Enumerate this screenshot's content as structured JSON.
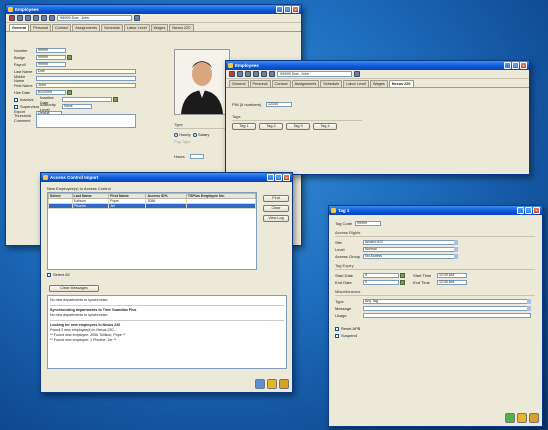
{
  "employees_window": {
    "title": "Employees",
    "selector_value": "99999 Doe, John",
    "tabs": [
      "General",
      "Personal",
      "Contact",
      "Assignments",
      "Schedule",
      "Labor Level",
      "Wages",
      "Nexus 220"
    ],
    "fields": [
      {
        "label": "Number",
        "value": "99999"
      },
      {
        "label": "Badge",
        "value": "99999"
      },
      {
        "label": "Payroll",
        "value": "99999"
      },
      {
        "label": "Last Name",
        "value": "Doe"
      },
      {
        "label": "Middle Name",
        "value": ""
      },
      {
        "label": "First Name",
        "value": "John"
      },
      {
        "label": "Hire Date",
        "value": "6/1/2009"
      }
    ],
    "inactive_label": "Inactive",
    "inactive_date_label": "Inactive Date",
    "supervisor_label": "Supervisor",
    "authority_label": "Authority Level",
    "authority_value": "None",
    "export_threshold_label": "Export Threshold",
    "export_threshold_value": "Default",
    "comment_label": "Comment",
    "type_group": "Type",
    "type_options": [
      "Hourly",
      "Salary"
    ],
    "pay_type_label": "Pay Type",
    "hours_label": "Hours"
  },
  "nexus_window": {
    "title": "Employees",
    "selector_value": "99999 Doe, John",
    "tabs": [
      "General",
      "Personal",
      "Contact",
      "Assignments",
      "Schedule",
      "Labor Level",
      "Wages",
      "Nexus 220"
    ],
    "pin_label": "PIN (5 numbers)",
    "pin_value": "12345",
    "tags_group": "Tags",
    "tags": [
      "Tag 1",
      "Tag 2",
      "Tag 3",
      "Tag 4"
    ]
  },
  "access_window": {
    "title": "Access Control Import",
    "subtitle": "New Employee(s) to Access Control",
    "columns": [
      "Select",
      "Last Name",
      "First Name",
      "Access ID%",
      "TSPlus Employee No."
    ],
    "rows": [
      {
        "select": "",
        "last": "Tullison",
        "first": "Pope",
        "access": "2056",
        "tsplus": ""
      },
      {
        "select": "",
        "last": "Phoebe",
        "first": "Jer",
        "access": "",
        "tsplus": ""
      }
    ],
    "buttons": [
      "Find",
      "Clear",
      "View Log"
    ],
    "select_all_label": "Select All",
    "clear_messages_label": "Clear Messages",
    "log_lines": [
      "No new departments to synchronize.",
      "Synchronizing departments to Time Guardian Plus",
      "No new departments to synchronize.",
      "Looking for new employees in Nexus 220",
      "Found 2 new employee(s) in Nexus 220...",
      "** Found new employee: 2056 Tullison, Pope **",
      "** Found new employee: 1 Phoebe, Jer **"
    ]
  },
  "tag_window": {
    "title": "Tag 1",
    "tag_code_label": "Tag Code",
    "tag_code_value": "99999",
    "access_rights_group": "Access Rights",
    "site_label": "Site",
    "site_value": "Amano ACI",
    "level_label": "Level",
    "level_value": "Normal",
    "access_group_label": "Access Group",
    "access_group_value": "No Access",
    "tag_expiry_group": "Tag Expiry",
    "start_date_label": "Start Date",
    "start_date_value": "0",
    "start_time_label": "Start Time",
    "start_time_value": "12:00 AM",
    "end_date_label": "End Date",
    "end_date_value": "0",
    "end_time_label": "End Time",
    "end_time_value": "12:00 AM",
    "misc_group": "Miscellaneous",
    "type_label": "Type",
    "type_value": "Any Tag",
    "message_label": "Message",
    "usage_label": "Usage",
    "reset_apb_label": "Reset APB",
    "suspend_label": "Suspend"
  },
  "colors": {
    "titlebar": "#0a55d8",
    "window_bg": "#ece9d8",
    "desktop": "#1f6fc0",
    "ok": "#4fb34a",
    "cancel": "#e7b52a",
    "help": "#d6a22a"
  }
}
